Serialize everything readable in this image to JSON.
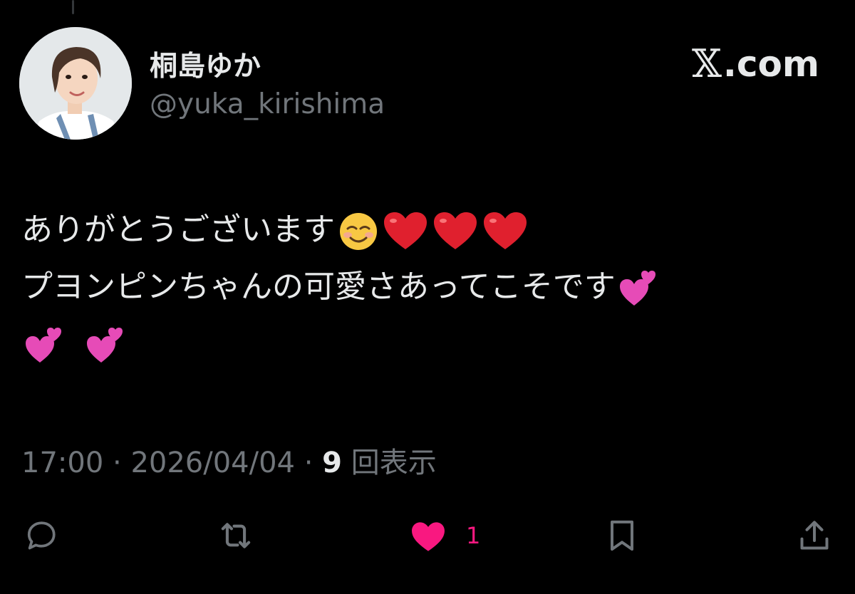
{
  "tweet": {
    "display_name": "桐島ゆか",
    "handle": "@yuka_kirishima",
    "brand": {
      "x_mark": "𝕏",
      "domain": ".com"
    },
    "body": {
      "line1": "ありがとうございます",
      "line2": "プヨンピンちゃんの可愛さあってこそです"
    },
    "emoji_names": [
      "smiling-face-icon",
      "red-heart-icon",
      "red-heart-icon",
      "red-heart-icon",
      "two-hearts-icon",
      "two-hearts-icon",
      "two-hearts-icon"
    ],
    "meta": {
      "time": "17:00",
      "separator": " · ",
      "date": "2026/04/04",
      "views_count": "9",
      "views_label": " 回表示"
    },
    "actions": {
      "like_count": "1",
      "icons": [
        "reply-icon",
        "repost-icon",
        "like-icon",
        "bookmark-icon",
        "share-icon"
      ]
    }
  },
  "colors": {
    "background": "#000000",
    "primary_text": "#e7e9ea",
    "secondary_text": "#71767b",
    "like_pink": "#f91880"
  }
}
